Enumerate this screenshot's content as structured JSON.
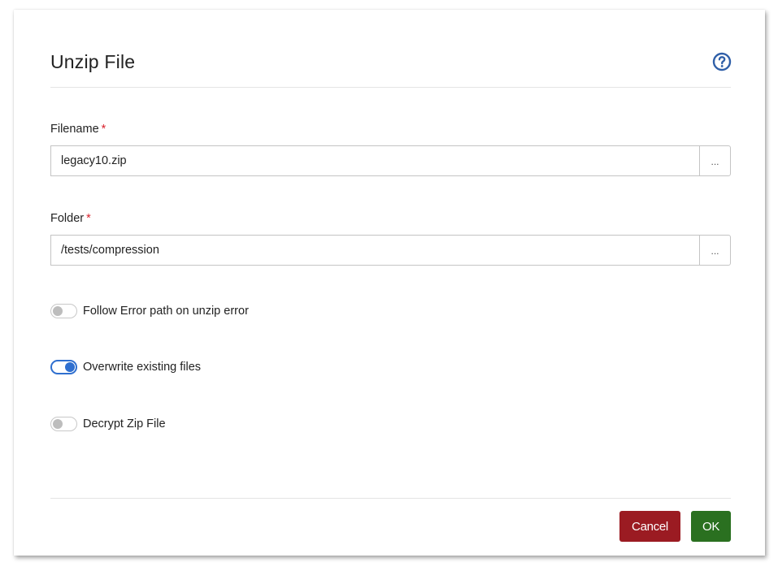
{
  "dialog": {
    "title": "Unzip File",
    "help_icon": "question-circle-icon"
  },
  "fields": {
    "filename": {
      "label": "Filename",
      "required_mark": "*",
      "value": "legacy10.zip",
      "browse_label": "..."
    },
    "folder": {
      "label": "Folder",
      "required_mark": "*",
      "value": "/tests/compression",
      "browse_label": "..."
    }
  },
  "toggles": [
    {
      "label": "Follow Error path on unzip error",
      "checked": false
    },
    {
      "label": "Overwrite existing files",
      "checked": true
    },
    {
      "label": "Decrypt Zip File",
      "checked": false
    }
  ],
  "buttons": {
    "cancel": "Cancel",
    "ok": "OK"
  },
  "colors": {
    "accent_blue": "#2f6fcf",
    "required_red": "#d9232e",
    "cancel_bg": "#9b1b22",
    "ok_bg": "#2a7020"
  }
}
